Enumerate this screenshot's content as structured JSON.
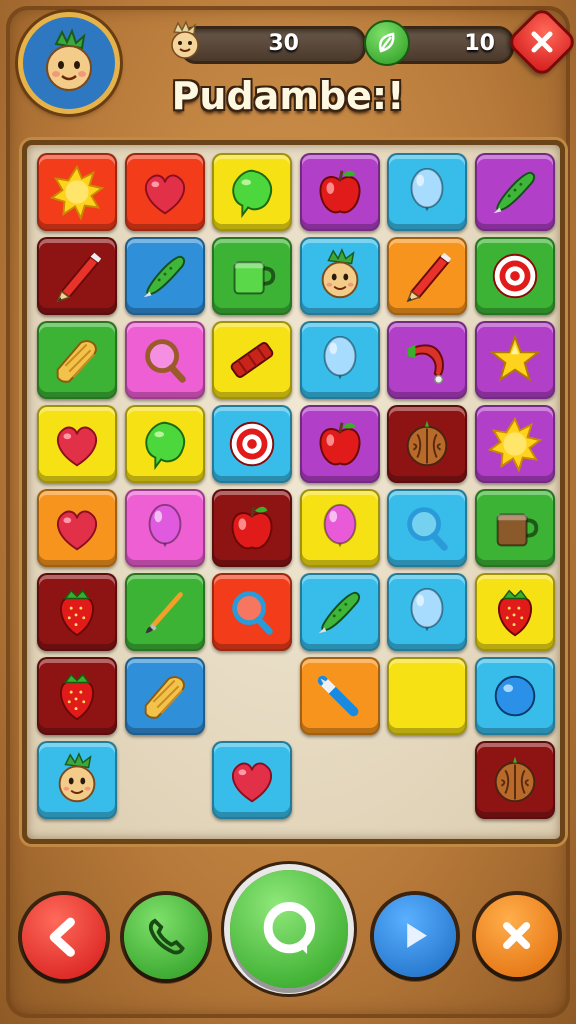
{
  "header": {
    "title": "Pudambe:!",
    "score_value": "30",
    "moves_value": "10"
  },
  "colors": {
    "red": "#f23c1a",
    "yellow": "#f6e114",
    "purple": "#b23fc8",
    "cyan": "#38bdea",
    "green": "#3cb334",
    "darkred": "#8e1414",
    "blue": "#2f8fd8",
    "orange": "#f7941d",
    "pink": "#ef5fd4"
  },
  "board": {
    "tiles": [
      {
        "row": 0,
        "col": 0,
        "bg": "red",
        "icon": "sun-icon"
      },
      {
        "row": 0,
        "col": 1,
        "bg": "red",
        "icon": "heart-icon"
      },
      {
        "row": 0,
        "col": 2,
        "bg": "yellow",
        "icon": "leaf-icon"
      },
      {
        "row": 0,
        "col": 3,
        "bg": "purple",
        "icon": "apple-icon"
      },
      {
        "row": 0,
        "col": 4,
        "bg": "cyan",
        "icon": "balloon-icon"
      },
      {
        "row": 0,
        "col": 5,
        "bg": "purple",
        "icon": "cucumber-icon"
      },
      {
        "row": 1,
        "col": 0,
        "bg": "darkred",
        "icon": "pencil-icon"
      },
      {
        "row": 1,
        "col": 1,
        "bg": "blue",
        "icon": "cucumber-icon"
      },
      {
        "row": 1,
        "col": 2,
        "bg": "green",
        "icon": "mug-icon"
      },
      {
        "row": 1,
        "col": 3,
        "bg": "cyan",
        "icon": "mascot-icon"
      },
      {
        "row": 1,
        "col": 4,
        "bg": "orange",
        "icon": "pencil-icon"
      },
      {
        "row": 1,
        "col": 5,
        "bg": "green",
        "icon": "target-icon"
      },
      {
        "row": 2,
        "col": 0,
        "bg": "green",
        "icon": "bread-icon"
      },
      {
        "row": 2,
        "col": 1,
        "bg": "pink",
        "icon": "magnifier-icon"
      },
      {
        "row": 2,
        "col": 2,
        "bg": "yellow",
        "icon": "dynamite-icon"
      },
      {
        "row": 2,
        "col": 3,
        "bg": "cyan",
        "icon": "balloon-icon"
      },
      {
        "row": 2,
        "col": 4,
        "bg": "purple",
        "icon": "horn-icon"
      },
      {
        "row": 2,
        "col": 5,
        "bg": "purple",
        "icon": "star-icon"
      },
      {
        "row": 3,
        "col": 0,
        "bg": "yellow",
        "icon": "heart-icon"
      },
      {
        "row": 3,
        "col": 1,
        "bg": "yellow",
        "icon": "leaf-icon"
      },
      {
        "row": 3,
        "col": 2,
        "bg": "cyan",
        "icon": "target-icon"
      },
      {
        "row": 3,
        "col": 3,
        "bg": "purple",
        "icon": "apple-icon"
      },
      {
        "row": 3,
        "col": 4,
        "bg": "darkred",
        "icon": "walnut-icon"
      },
      {
        "row": 3,
        "col": 5,
        "bg": "purple",
        "icon": "sun-icon"
      },
      {
        "row": 4,
        "col": 0,
        "bg": "orange",
        "icon": "heart-icon"
      },
      {
        "row": 4,
        "col": 1,
        "bg": "pink",
        "icon": "balloon-icon"
      },
      {
        "row": 4,
        "col": 2,
        "bg": "darkred",
        "icon": "apple-icon"
      },
      {
        "row": 4,
        "col": 3,
        "bg": "yellow",
        "icon": "balloon-icon"
      },
      {
        "row": 4,
        "col": 4,
        "bg": "cyan",
        "icon": "magnifier-icon"
      },
      {
        "row": 4,
        "col": 5,
        "bg": "green",
        "icon": "mug-icon"
      },
      {
        "row": 5,
        "col": 0,
        "bg": "darkred",
        "icon": "strawberry-icon"
      },
      {
        "row": 5,
        "col": 1,
        "bg": "green",
        "icon": "paintbrush-icon"
      },
      {
        "row": 5,
        "col": 2,
        "bg": "red",
        "icon": "magnifier-icon"
      },
      {
        "row": 5,
        "col": 3,
        "bg": "cyan",
        "icon": "cucumber-icon"
      },
      {
        "row": 5,
        "col": 4,
        "bg": "cyan",
        "icon": "balloon-icon"
      },
      {
        "row": 5,
        "col": 5,
        "bg": "yellow",
        "icon": "strawberry-icon"
      },
      {
        "row": 6,
        "col": 0,
        "bg": "darkred",
        "icon": "strawberry-icon"
      },
      {
        "row": 6,
        "col": 1,
        "bg": "blue",
        "icon": "bread-icon"
      },
      {
        "row": 6,
        "col": 3,
        "bg": "orange",
        "icon": "pen-icon"
      },
      {
        "row": 6,
        "col": 4,
        "bg": "yellow",
        "icon": "empty"
      },
      {
        "row": 6,
        "col": 5,
        "bg": "cyan",
        "icon": "ball-icon"
      },
      {
        "row": 7,
        "col": 0,
        "bg": "cyan",
        "icon": "mascot-icon"
      },
      {
        "row": 7,
        "col": 2,
        "bg": "cyan",
        "icon": "heart-icon"
      },
      {
        "row": 7,
        "col": 5,
        "bg": "darkred",
        "icon": "walnut-icon"
      }
    ]
  },
  "bottom_buttons": [
    {
      "name": "back-button",
      "icon": "chevron-left-icon",
      "color": "#e8231c"
    },
    {
      "name": "phone-button",
      "icon": "phone-icon",
      "color": "#2fae2a"
    },
    {
      "name": "chat-button",
      "icon": "chat-icon",
      "color": "#2fae2a"
    },
    {
      "name": "play-button",
      "icon": "play-icon",
      "color": "#1f7fd6"
    },
    {
      "name": "close-button",
      "icon": "close-icon",
      "color": "#f27a14"
    }
  ]
}
